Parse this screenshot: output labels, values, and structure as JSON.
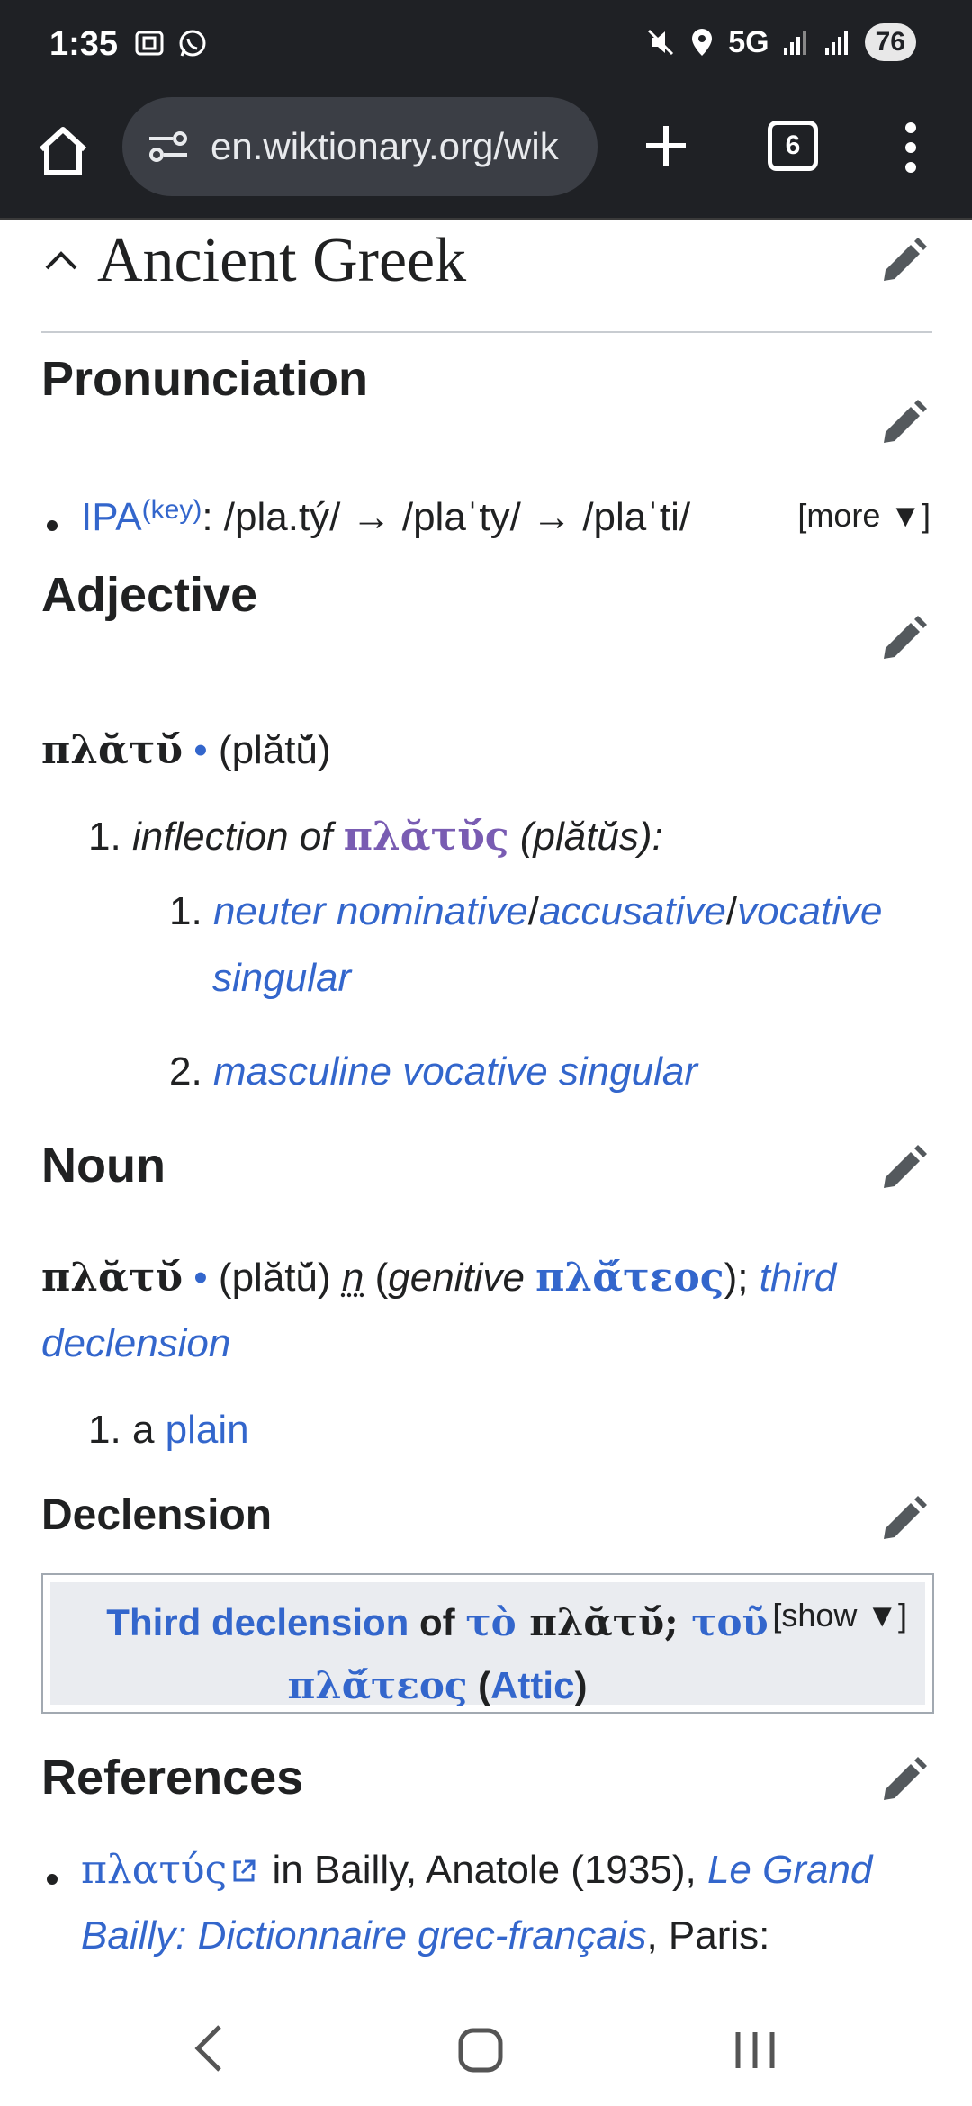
{
  "status_bar": {
    "time": "1:35",
    "network": "5G",
    "battery": "76"
  },
  "browser": {
    "url": "en.wiktionary.org/wik",
    "tab_count": "6"
  },
  "page": {
    "language": "Ancient Greek",
    "pronunciation": {
      "heading": "Pronunciation",
      "ipa_label": "IPA",
      "key_label": "(key)",
      "ipa_text": ": /pla.tý/ → /plaˈty/ → /plaˈti/",
      "more_label": "[more ▼]"
    },
    "adjective": {
      "heading": "Adjective",
      "headword": "πλᾰτῠ́",
      "dot": " • ",
      "translit": "(plătŭ́)",
      "sense1_prefix": "inflection of ",
      "sense1_lemma": "πλᾰτῠ́ς",
      "sense1_translit": " (plătŭ́s)",
      "sense1_suffix": ":",
      "sub1_a": "neuter nominative",
      "sub1_b": "accusative",
      "sub1_c": "vocative",
      "sub1_d": "singular",
      "sub2": "masculine vocative singular",
      "num1": "1.",
      "num2": "2."
    },
    "noun": {
      "heading": "Noun",
      "headword": "πλᾰτῠ́",
      "dot": " • ",
      "translit": "(plătŭ́) ",
      "gender": "n",
      "genitive_open": " (",
      "genitive_label": "genitive",
      "genitive_form": "πλᾰ́τεος",
      "genitive_close": "); ",
      "decl_link": "third",
      "decl_link2": "declension",
      "sense_num": "1.",
      "sense_prefix": "a ",
      "sense_link": "plain"
    },
    "declension": {
      "heading": "Declension",
      "title_link": "Third declension",
      "of": " of ",
      "article1": "τὸ",
      "form1": " πλᾰτῠ́; ",
      "article2": "τοῦ",
      "form2": "πλᾰ́τεος",
      "paren_open": " (",
      "dialect": "Attic",
      "paren_close": ")",
      "show_label": "[show ▼]"
    },
    "references": {
      "heading": "References",
      "entry_link": "πλατύς",
      "entry_text": " in Bailly, Anatole (1935), ",
      "book_title_1": "Le Grand",
      "book_title_2": "Bailly: Dictionnaire grec-français",
      "entry_tail": ", Paris:"
    }
  },
  "colors": {
    "link": "#3366cc",
    "visited": "#795cb2",
    "chrome_bg": "#1f2125"
  }
}
